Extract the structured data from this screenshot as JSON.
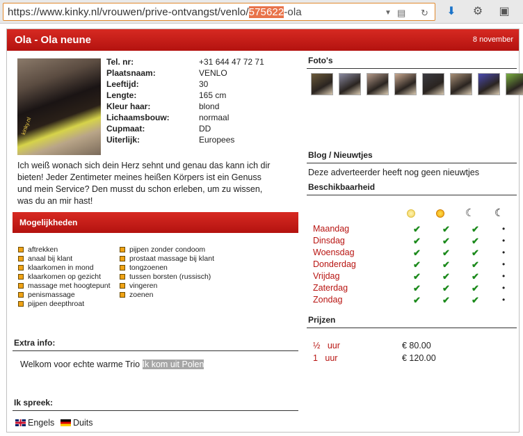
{
  "browser": {
    "url_prefix": "https://www.kinky.nl/vrouwen/prive-ontvangst/venlo/",
    "url_highlight": "575622",
    "url_suffix": "-ola"
  },
  "header": {
    "title": "Ola - Ola neune",
    "date": "8 november"
  },
  "photo": {
    "watermark": "kinky.nl"
  },
  "profile": {
    "labels": [
      "Tel. nr:",
      "Plaatsnaam:",
      "Leeftijd:",
      "Lengte:",
      "Kleur haar:",
      "Lichaamsbouw:",
      "Cupmaat:",
      "Uiterlijk:"
    ],
    "values": [
      "+31 644 47 72 71",
      "VENLO",
      "30",
      "165 cm",
      "blond",
      "normaal",
      "DD",
      "Europees"
    ]
  },
  "description": "Ich weiß wonach sich dein Herz sehnt und genau das kann ich dir bieten! Jeder Zentimeter meines heißen Körpers ist ein Genuss und mein Service? Den musst du schon erleben, um zu wissen, was du an mir hast!",
  "mogelijkheden": {
    "title": "Mogelijkheden",
    "col1": [
      "aftrekken",
      "anaal bij klant",
      "klaarkomen in mond",
      "klaarkomen op gezicht",
      "massage met hoogtepunt",
      "penismassage",
      "pijpen deepthroat"
    ],
    "col2": [
      "pijpen zonder condoom",
      "prostaat massage bij klant",
      "tongzoenen",
      "tussen borsten (russisch)",
      "vingeren",
      "zoenen"
    ]
  },
  "extra": {
    "title": "Extra info:",
    "text": "Welkom voor echte warme Trio ",
    "highlight": "Ik kom uit Polen"
  },
  "languages": {
    "title": "Ik spreek:",
    "items": [
      "Engels",
      "Duits"
    ]
  },
  "photos": {
    "title": "Foto's",
    "colors": [
      "#6b5a3a",
      "#8a8aa0",
      "#b49a8a",
      "#c8a890",
      "#3a3a40",
      "#a89078",
      "#4a4ab0",
      "#7ab040"
    ]
  },
  "blog": {
    "title": "Blog / Nieuwtjes",
    "text": "Deze adverteerder heeft nog geen nieuwtjes"
  },
  "availability": {
    "title": "Beschikbaarheid",
    "days": [
      "Maandag",
      "Dinsdag",
      "Woensdag",
      "Donderdag",
      "Vrijdag",
      "Zaterdag",
      "Zondag"
    ],
    "check": "✔",
    "dot": "•",
    "moon": "☾"
  },
  "prices": {
    "title": "Prijzen",
    "units": [
      "½   uur",
      "1   uur"
    ],
    "values": [
      "€ 80.00",
      "€ 120.00"
    ]
  },
  "colors": {
    "accent": "#c41a16",
    "link_red": "#b81512",
    "check_green": "#1c8a1c"
  }
}
